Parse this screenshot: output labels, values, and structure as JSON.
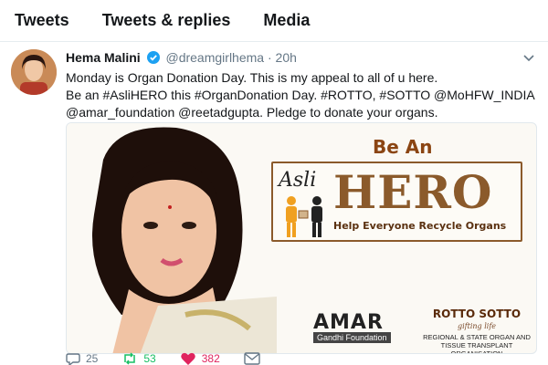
{
  "tabs": [
    "Tweets",
    "Tweets & replies",
    "Media"
  ],
  "tweet": {
    "name": "Hema Malini",
    "handle": "@dreamgirlhema",
    "separator": "·",
    "time": "20h",
    "text_lines": [
      "Monday is Organ Donation Day. This is my appeal to all of u here.",
      "Be an #AsliHERO this #OrganDonation Day. #ROTTO, #SOTTO @MoHFW_INDIA",
      "@amar_foundation @reetadgupta. Pledge to donate your organs."
    ]
  },
  "media": {
    "be_an": "Be An",
    "asli": "Asli",
    "hero": "HERO",
    "tagline": "Help Everyone Recycle Organs",
    "amar": "AMAR",
    "amar_sub": "Gandhi Foundation",
    "rotto": "ROTTO SOTTO",
    "rotto_tag": "gifting life",
    "rotto_desc": "REGIONAL & STATE ORGAN AND TISSUE TRANSPLANT ORGANISATION"
  },
  "actions": {
    "reply_count": "25",
    "retweet_count": "53",
    "like_count": "382"
  },
  "colors": {
    "verified": "#1da1f2",
    "retweet": "#17bf63",
    "like": "#e0245e",
    "muted": "#657786"
  }
}
